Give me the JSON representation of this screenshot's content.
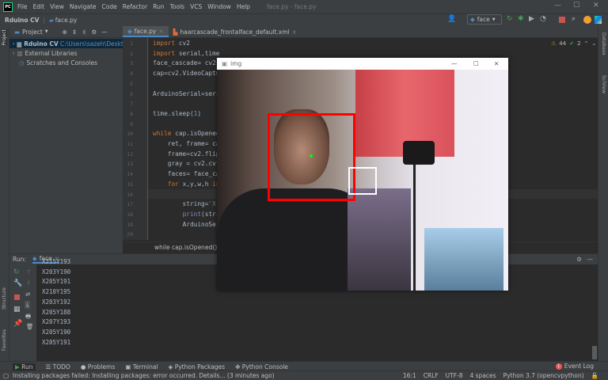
{
  "menu": {
    "items": [
      "File",
      "Edit",
      "View",
      "Navigate",
      "Code",
      "Refactor",
      "Run",
      "Tools",
      "VCS",
      "Window",
      "Help"
    ],
    "title": "face.py - face.py"
  },
  "nav": {
    "project": "Rduino CV",
    "file": "face.py",
    "run_config": "face"
  },
  "project_panel": {
    "title": "Project",
    "tree": [
      {
        "label": "Rduino CV",
        "path": "C:\\Users\\sazeh\\Desktop\\Rd"
      },
      {
        "label": "External Libraries"
      },
      {
        "label": "Scratches and Consoles"
      }
    ]
  },
  "tabs": [
    {
      "label": "face.py"
    },
    {
      "label": "haarcascade_frontalface_default.xml"
    }
  ],
  "inspections": {
    "warnings": "44",
    "ok": "2"
  },
  "code": [
    "import cv2",
    "import serial,time",
    "face_cascade= cv2.",
    "cap=cv2.VideoCaptu",
    "",
    "ArduinoSerial=seri",
    "",
    "time.sleep(1)",
    "",
    "while cap.isOpened",
    "    ret, frame= ca",
    "    frame=cv2.flip",
    "    gray = cv2.cvt",
    "    faces= face_ca",
    "    for x,y,w,h in",
    "",
    "        string='X",
    "        print(stri",
    "        ArduinoSer",
    ""
  ],
  "breadcrumb": "while cap.isOpened()",
  "run": {
    "label": "Run:",
    "tab": "face",
    "output": [
      "X215Y193",
      "X203Y190",
      "X205Y191",
      "X210Y195",
      "X203Y192",
      "X205Y188",
      "X207Y193",
      "X205Y190",
      "X205Y191"
    ]
  },
  "bottom_tools": [
    "Run",
    "TODO",
    "Problems",
    "Terminal",
    "Python Packages",
    "Python Console"
  ],
  "event_log": {
    "label": "Event Log",
    "count": "1"
  },
  "status": {
    "message": "Installing packages failed: Installing packages: error occurred. Details... (3 minutes ago)",
    "position": "16:1",
    "line_sep": "CRLF",
    "encoding": "UTF-8",
    "indent": "4 spaces",
    "interpreter": "Python 3.7 (opencvpython)"
  },
  "side_labels": {
    "project": "Project",
    "structure": "Structure",
    "favorites": "Favorites",
    "database": "Database",
    "sciview": "SciView"
  },
  "cv_window": {
    "title": "img"
  },
  "colors": {
    "face_box": "#ff0000",
    "target_box": "#ffffff",
    "accent": "#4a88c7"
  }
}
